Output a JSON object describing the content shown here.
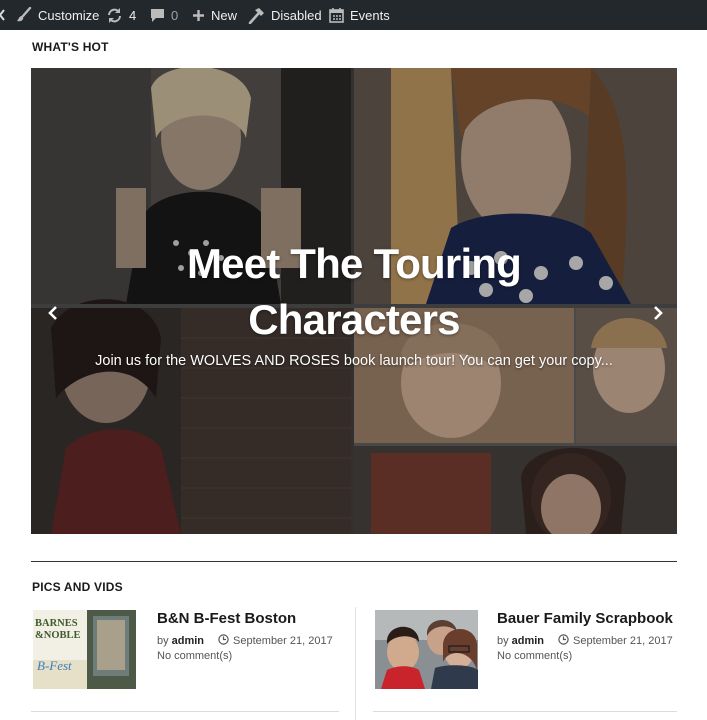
{
  "adminbar": {
    "customize_label": "Customize",
    "updates_count": "4",
    "comments_count": "0",
    "new_label": "New",
    "disabled_label": "Disabled",
    "events_label": "Events"
  },
  "whats_hot": {
    "heading": "WHAT'S HOT",
    "slide": {
      "title_line1": "Meet The Touring",
      "title_line2": "Characters",
      "excerpt": "Join us for the WOLVES AND ROSES book launch tour! You can get your copy..."
    }
  },
  "pics_and_vids": {
    "heading": "PICS AND VIDS",
    "posts": [
      {
        "title": "B&N B-Fest Boston",
        "by_label": "by",
        "author": "admin",
        "date": "September 21, 2017",
        "comments": "No comment(s)",
        "thumb_text_1": "BARNES",
        "thumb_text_2": "&NOBLE",
        "thumb_text_3": "B-Fest"
      },
      {
        "title": "Bauer Family Scrapbook",
        "by_label": "by",
        "author": "admin",
        "date": "September 21, 2017",
        "comments": "No comment(s)"
      }
    ]
  },
  "icons": {
    "brush": "brush-icon",
    "refresh": "refresh-icon",
    "comment": "comment-icon",
    "plus": "plus-icon",
    "hammer": "hammer-icon",
    "calendar": "calendar-icon",
    "clock": "clock-icon",
    "arrow_left": "chevron-left-icon",
    "arrow_right": "chevron-right-icon"
  }
}
